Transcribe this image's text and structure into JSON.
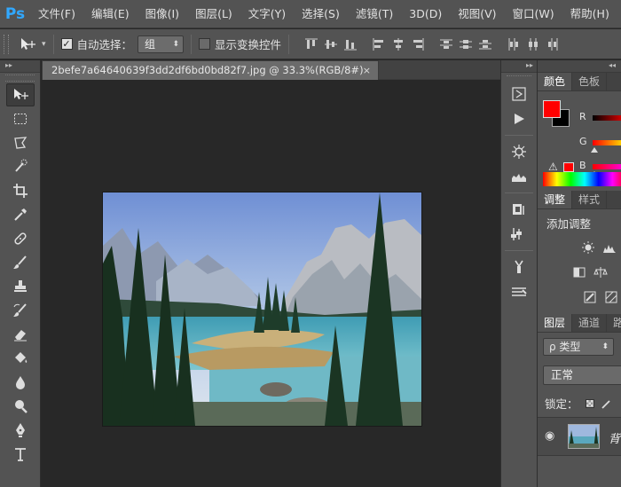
{
  "app": {
    "logo": "Ps",
    "accent": "#31a8ff"
  },
  "menu": [
    "文件(F)",
    "编辑(E)",
    "图像(I)",
    "图层(L)",
    "文字(Y)",
    "选择(S)",
    "滤镜(T)",
    "3D(D)",
    "视图(V)",
    "窗口(W)",
    "帮助(H)"
  ],
  "options": {
    "auto_select_label": "自动选择：",
    "auto_select_checked": true,
    "auto_select_value": "组",
    "show_transform_label": "显示变换控件",
    "show_transform_checked": false
  },
  "toolbar": {
    "collapse_glyph": "▸▸",
    "tools": [
      "move-tool",
      "marquee-tool",
      "lasso-tool",
      "quick-select-tool",
      "crop-tool",
      "eyedropper-tool",
      "healing-brush-tool",
      "brush-tool",
      "clone-stamp-tool",
      "history-brush-tool",
      "eraser-tool",
      "paint-bucket-tool",
      "blur-tool",
      "dodge-tool",
      "pen-tool",
      "type-tool"
    ]
  },
  "document": {
    "tab_title": "2befe7a64640639f3dd2df6bd0bd82f7.jpg @ 33.3%(RGB/8#)",
    "close_glyph": "×"
  },
  "right_panel": {
    "collapse_glyph": "◂◂",
    "color_tabs": [
      "颜色",
      "色板"
    ],
    "foreground_color": "#ff0000",
    "background_color": "#000000",
    "channels": [
      "R",
      "G",
      "B"
    ],
    "warning_glyph": "⚠",
    "adjust_tabs": [
      "调整",
      "样式"
    ],
    "adjust_title": "添加调整",
    "layer_tabs": [
      "图层",
      "通道",
      "路"
    ],
    "kind_filter": "ρ 类型",
    "kind_arrow": "⬍",
    "blend_mode": "正常",
    "lock_label": "锁定：",
    "layer_name": "背",
    "eye_glyph": "◉"
  }
}
